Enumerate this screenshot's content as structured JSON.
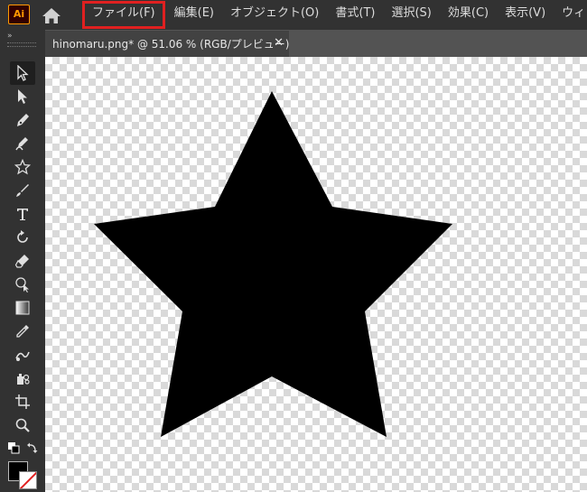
{
  "app": {
    "logo": "Ai"
  },
  "menu": {
    "items": [
      "ファイル(F)",
      "編集(E)",
      "オブジェクト(O)",
      "書式(T)",
      "選択(S)",
      "効果(C)",
      "表示(V)",
      "ウィン"
    ],
    "highlighted": "ファイル(F)",
    "highlight_color": "#e02020"
  },
  "document_tab": {
    "title": "hinomaru.png* @ 51.06 % (RGB/プレビュー)",
    "close": "✕"
  },
  "tools": [
    "selection-tool",
    "direct-selection-tool",
    "pen-tool",
    "curvature-tool",
    "star-tool",
    "paintbrush-tool",
    "type-tool",
    "rotate-tool",
    "eraser-tool",
    "shape-builder-tool",
    "gradient-tool",
    "eyedropper-tool",
    "blend-tool",
    "symbol-sprayer-tool",
    "artboard-tool",
    "zoom-tool"
  ],
  "colors": {
    "fill": "#000000",
    "stroke": "none",
    "canvas_shape": "#000000"
  },
  "canvas": {
    "shape": "star"
  }
}
